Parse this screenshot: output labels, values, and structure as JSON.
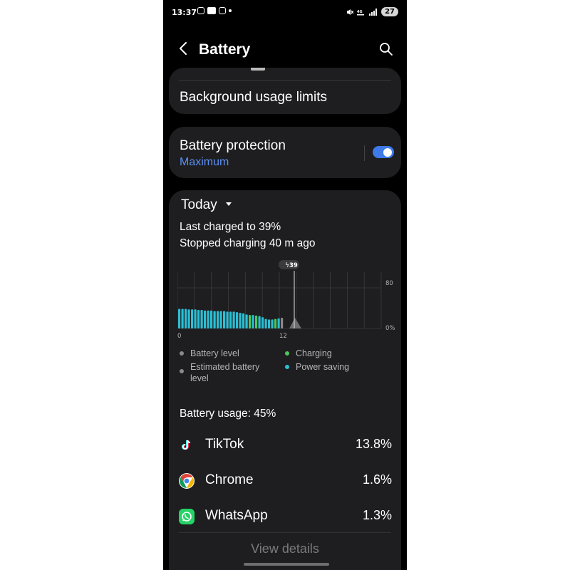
{
  "status_bar": {
    "time": "13:37",
    "battery": "27"
  },
  "header": {
    "title": "Battery"
  },
  "settings": {
    "background_usage_limits": "Background usage limits",
    "battery_protection": {
      "label": "Battery protection",
      "value": "Maximum",
      "enabled": true
    }
  },
  "usage": {
    "period": "Today",
    "last_charged": "Last charged to 39%",
    "stopped_charging": "Stopped charging 40 m ago",
    "chart": {
      "marker_label": "39",
      "y_ticks": [
        "80",
        "0%"
      ],
      "x_ticks": [
        "0",
        "12"
      ]
    },
    "legend": {
      "battery_level": "Battery level",
      "charging": "Charging",
      "estimated": "Estimated battery level",
      "power_saving": "Power saving"
    },
    "title": "Battery usage: 45%",
    "apps": [
      {
        "name": "TikTok",
        "percent": "13.8%",
        "icon": "tiktok-icon"
      },
      {
        "name": "Chrome",
        "percent": "1.6%",
        "icon": "chrome-icon"
      },
      {
        "name": "WhatsApp",
        "percent": "1.3%",
        "icon": "whatsapp-icon"
      }
    ],
    "view_details": "View details"
  },
  "colors": {
    "accent_blue": "#5b8ff0",
    "toggle_on": "#3e7ae8",
    "power_saving": "#2bbfd4",
    "charging": "#4cc85a",
    "card_bg": "#1e1e21"
  },
  "chart_data": {
    "type": "bar",
    "x_ticks": [
      "0",
      "12"
    ],
    "y_ticks": [
      "80",
      "0%"
    ],
    "marker": "39",
    "series": [
      {
        "name": "Power saving",
        "values": [
          35,
          35,
          35,
          34,
          34,
          34,
          33,
          33,
          32,
          32,
          32,
          31,
          31,
          31,
          31,
          30,
          30,
          30,
          29,
          28,
          27,
          25,
          24,
          24,
          23,
          22,
          20,
          17,
          16,
          16,
          17,
          18,
          19,
          21,
          23,
          25
        ]
      },
      {
        "name": "Charging",
        "values": [
          0,
          0,
          0,
          0,
          0,
          0,
          0,
          0,
          0,
          0,
          0,
          0,
          0,
          0,
          0,
          0,
          0,
          0,
          0,
          0,
          0,
          0,
          0,
          0,
          0,
          0,
          0,
          0,
          0,
          0,
          0,
          0,
          0,
          0,
          0,
          0
        ]
      }
    ]
  }
}
